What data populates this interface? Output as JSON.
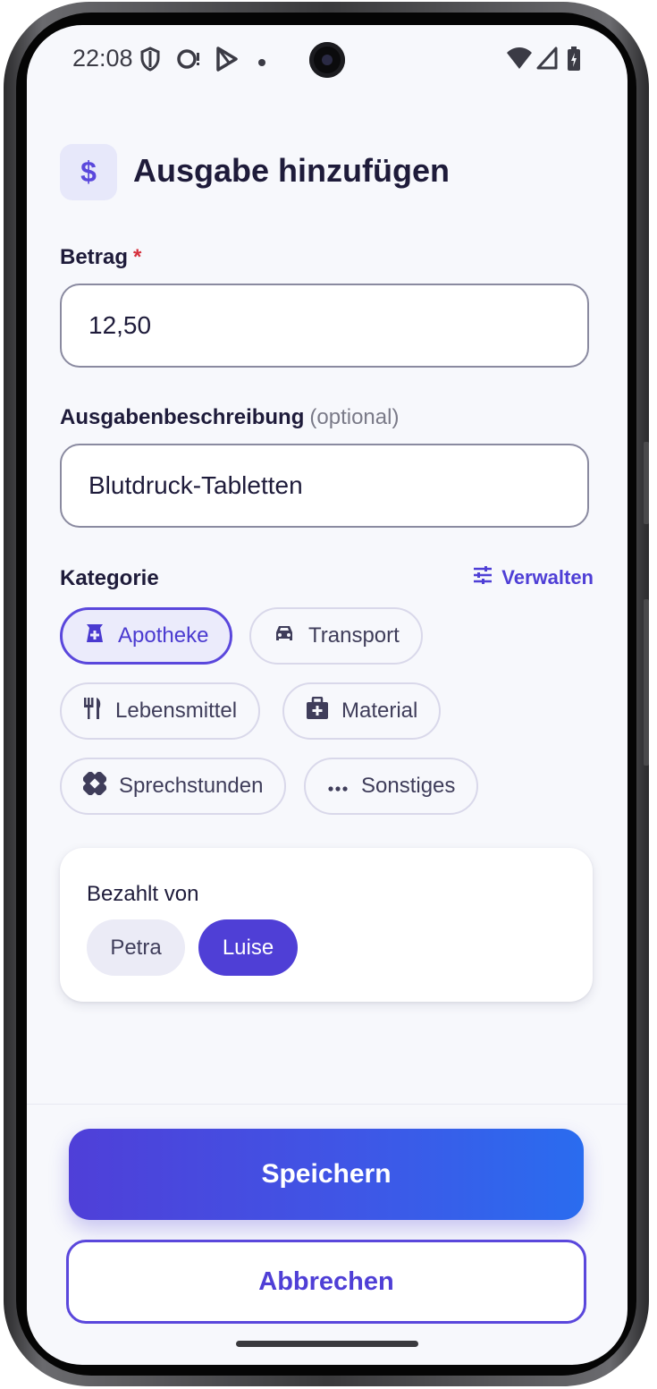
{
  "status_bar": {
    "time": "22:08"
  },
  "header": {
    "icon_glyph": "$",
    "title": "Ausgabe hinzufügen"
  },
  "amount": {
    "label": "Betrag",
    "required_mark": "*",
    "value": "12,50"
  },
  "description": {
    "label": "Ausgabenbeschreibung",
    "optional_hint": "(optional)",
    "value": "Blutdruck-Tabletten"
  },
  "category": {
    "label": "Kategorie",
    "manage_label": "Verwalten",
    "selected": "Apotheke",
    "chips": [
      {
        "label": "Apotheke",
        "icon": "pharmacy-icon"
      },
      {
        "label": "Transport",
        "icon": "car-icon"
      },
      {
        "label": "Lebensmittel",
        "icon": "fork-knife-icon"
      },
      {
        "label": "Material",
        "icon": "medical-bag-icon"
      },
      {
        "label": "Sprechstunden",
        "icon": "bandage-icon"
      },
      {
        "label": "Sonstiges",
        "icon": "more-horizontal-icon"
      }
    ]
  },
  "paid_by": {
    "label": "Bezahlt von",
    "selected": "Luise",
    "options": [
      "Petra",
      "Luise"
    ]
  },
  "actions": {
    "save_label": "Speichern",
    "cancel_label": "Abbrechen"
  },
  "colors": {
    "accent": "#4f3fd6",
    "required": "#d6303c",
    "gradient_end": "#2a6cef"
  }
}
